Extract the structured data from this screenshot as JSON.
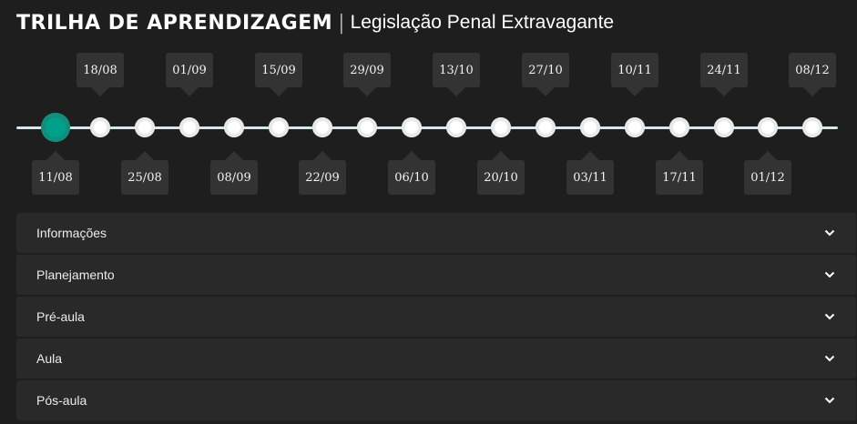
{
  "header": {
    "title": "TRILHA DE APRENDIZAGEM",
    "separator": "|",
    "subtitle": "Legislação Penal Extravagante"
  },
  "timeline": {
    "active_index": 0,
    "dates": [
      "11/08",
      "18/08",
      "25/08",
      "01/09",
      "08/09",
      "15/09",
      "22/09",
      "29/09",
      "06/10",
      "13/10",
      "20/10",
      "27/10",
      "03/11",
      "10/11",
      "17/11",
      "24/11",
      "01/12",
      "08/12"
    ]
  },
  "accordion": {
    "items": [
      {
        "label": "Informações"
      },
      {
        "label": "Planejamento"
      },
      {
        "label": "Pré-aula"
      },
      {
        "label": "Aula"
      },
      {
        "label": "Pós-aula"
      }
    ],
    "chevron_icon": "chevron-down-icon"
  },
  "colors": {
    "background": "#1e1e1e",
    "panel": "#292929",
    "active_node": "#00a08a",
    "track": "#d6e7ee"
  }
}
